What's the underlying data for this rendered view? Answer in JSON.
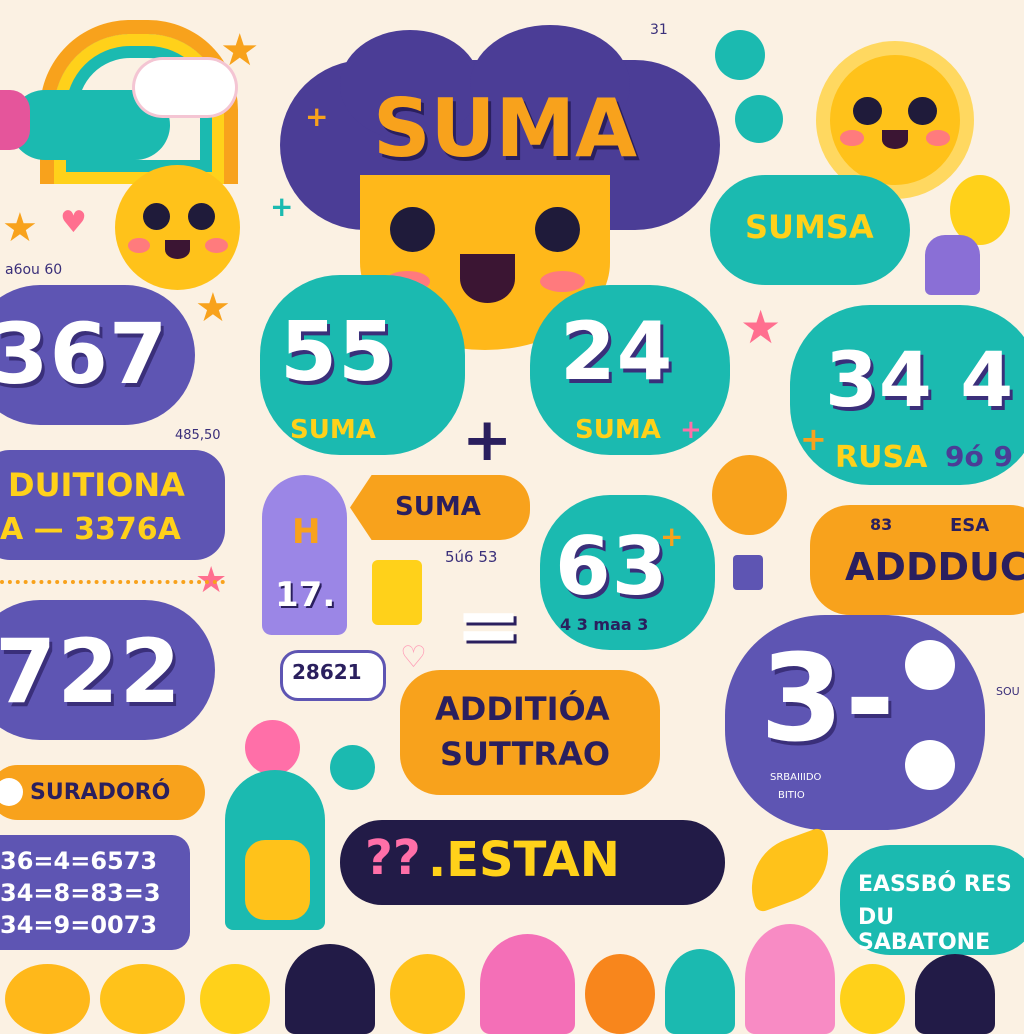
{
  "title": "SUMA",
  "colors": {
    "purple": "#5e55b3",
    "teal": "#1bbab0",
    "orange": "#f8a21c",
    "yellow": "#ffd11a",
    "pink": "#ff6f8f",
    "cream": "#fbf1e3"
  },
  "top_right_bubble": "SUMSA",
  "small_top_left": "a6ou 60",
  "left_big_number": "367",
  "left_small_number": "485,50",
  "left_addition": {
    "line1": "DUITIONA",
    "line2": "A — 3376A"
  },
  "left_big_number2": "722",
  "left_sumadoro": "SURADORÓ",
  "equations": [
    "36=4=6573",
    "34=8=83=3",
    "34=9=0073"
  ],
  "cloud_55": {
    "number": "55",
    "label": "SUMA"
  },
  "cloud_24": {
    "number": "24",
    "label": "SUMA"
  },
  "plus_sign": "+",
  "cloud_34": {
    "number": "34 4",
    "label": "RUSA",
    "extra": "9ó 9"
  },
  "arrow_suma": "SUMA",
  "tag_h": "H",
  "tag_17": "17.",
  "small_56": "5ú6 53",
  "cloud_63": {
    "number": "63",
    "label": "4 3 maa 3"
  },
  "equals": "=",
  "right_adduc": {
    "top_left": "83",
    "top_right": "ESA",
    "main": "ADDDUC"
  },
  "box_28621": "28621",
  "addition_bubble": {
    "line1": "ADDITIÓA",
    "line2": "SUTTRAO"
  },
  "estan": {
    "glyph": "??",
    "text": ".ESTAN"
  },
  "cloud_3": {
    "number": "3",
    "glyph": "-",
    "small1": "SRBAIIIDO",
    "small2": "BITIO"
  },
  "side_text_right": "SOU",
  "bottom_right_text": {
    "line1": "EASSBÓ RES",
    "line2": "DU SABATONE"
  },
  "tiny_top": "31"
}
